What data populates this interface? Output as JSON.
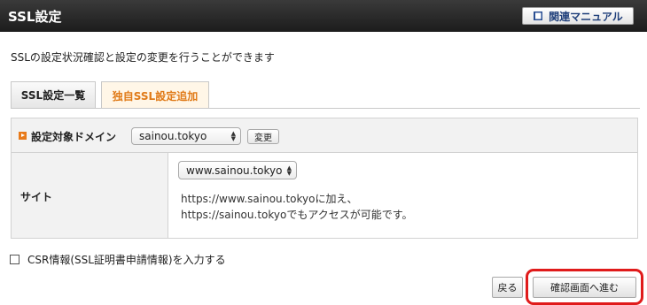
{
  "header": {
    "title": "SSL設定",
    "manual_button": {
      "label": "関連マニュアル",
      "icon": "book-icon"
    }
  },
  "description": "SSLの設定状況確認と設定の変更を行うことができます",
  "tabs": [
    {
      "label": "SSL設定一覧",
      "active": false
    },
    {
      "label": "独自SSL設定追加",
      "active": true
    }
  ],
  "form": {
    "domain_label": "設定対象ドメイン",
    "domain_select_value": "sainou.tokyo",
    "change_button": "変更",
    "site_label": "サイト",
    "site_select_value": "www.sainou.tokyo",
    "note_line1": "https://www.sainou.tokyoに加え、",
    "note_line2": "https://sainou.tokyoでもアクセスが可能です。"
  },
  "csr_checkbox": {
    "label": "CSR情報(SSL証明書申請情報)を入力する",
    "checked": false
  },
  "footer": {
    "back_button": "戻る",
    "confirm_button": "確認画面へ進む"
  },
  "colors": {
    "header_bg": "#2a2a2a",
    "active_tab_text": "#e07a18",
    "highlight": "#e01b1b",
    "manual_text": "#1e3e7a"
  }
}
